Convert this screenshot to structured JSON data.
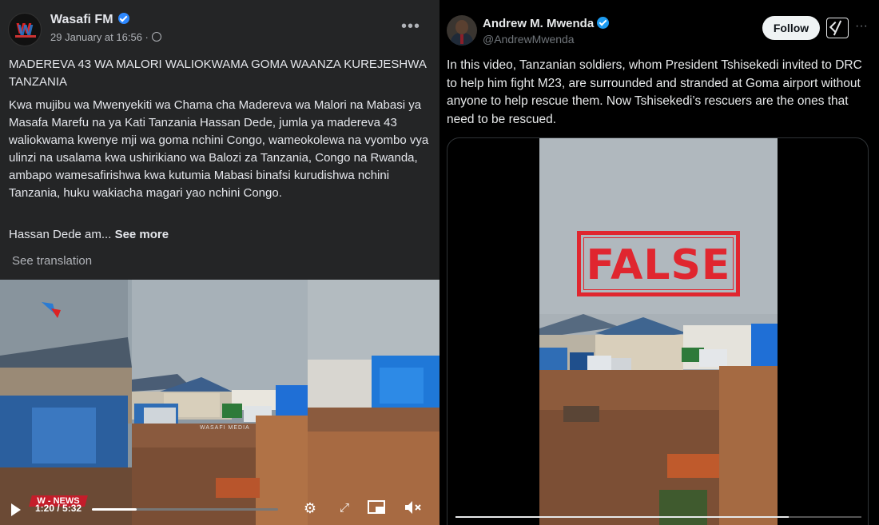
{
  "facebook_post": {
    "page_name": "Wasafi FM",
    "date": "29 January at 16:56 ·",
    "more_label": "•••",
    "title": "MADEREVA 43 WA MALORI WALIOKWAMA GOMA WAANZA KUREJESHWA TANZANIA",
    "body": "Kwa mujibu wa Mwenyekiti wa Chama cha Madereva wa Malori na Mabasi ya Masafa Marefu na ya Kati Tanzania  Hassan Dede, jumla ya madereva 43 waliokwama kwenye mji wa goma nchini Congo, wameokolewa na vyombo vya ulinzi na usalama kwa ushirikiano wa Balozi za Tanzania, Congo na Rwanda, ambapo wamesafirishwa kwa kutumia Mabasi binafsi kurudishwa nchini Tanzania, huku wakiacha magari yao nchini Congo.",
    "truncated_text": "Hassan Dede am...",
    "see_more_label": "See more",
    "see_translation_label": "See translation",
    "video": {
      "watermark": "WASAFI MEDIA",
      "news_badge": "W - NEWS",
      "time": "1:20 / 5:32",
      "progress_fraction": 0.241,
      "icons": [
        "play-icon",
        "settings-icon",
        "fullscreen-icon",
        "pip-icon",
        "mute-icon"
      ]
    }
  },
  "x_post": {
    "display_name": "Andrew M. Mwenda",
    "handle": "@AndrewMwenda",
    "follow_label": "Follow",
    "more_label": "···",
    "text": "In this video, Tanzanian soldiers, whom President Tshisekedi invited to DRC to help him fight M23, are surrounded and stranded at Goma airport without anyone to help rescue them. Now Tshisekedi’s rescuers are the ones that need to be rescued.",
    "false_stamp": "FALSE",
    "progress_fraction": 0.82
  },
  "colors": {
    "facebook_bg": "#242526",
    "x_bg": "#000000",
    "verified_blue": "#1d9bf0",
    "stamp_red": "#e0262f",
    "news_red": "#c41d2a"
  }
}
